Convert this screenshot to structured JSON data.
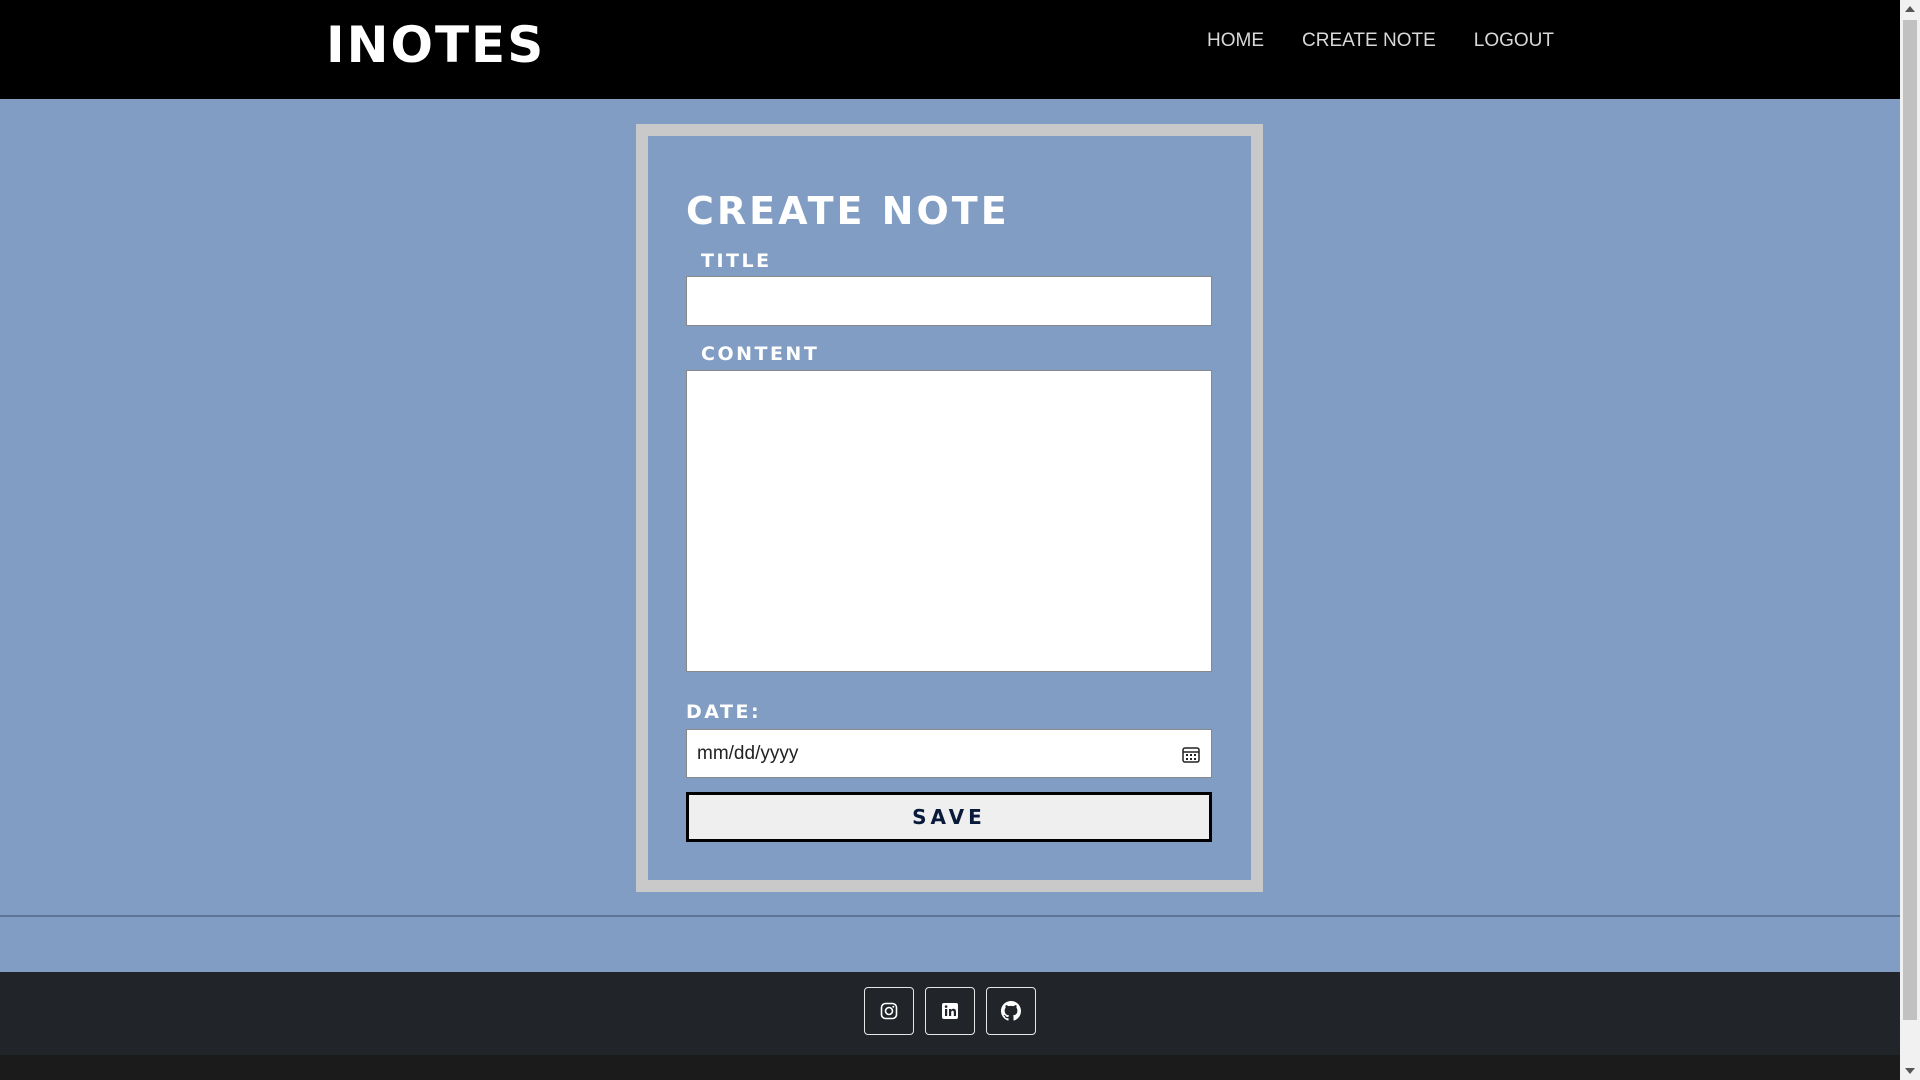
{
  "navbar": {
    "brand": "INOTES",
    "links": [
      {
        "label": "HOME"
      },
      {
        "label": "CREATE NOTE"
      },
      {
        "label": "LOGOUT"
      }
    ]
  },
  "form": {
    "heading": "CREATE NOTE",
    "title_label": "TITLE",
    "title_value": "",
    "content_label": "CONTENT",
    "content_value": "",
    "date_label": "DATE:",
    "date_placeholder": "mm/dd/yyyy",
    "save_label": "SAVE"
  },
  "footer": {
    "social_icons": [
      "instagram-icon",
      "linkedin-icon",
      "github-icon"
    ]
  },
  "colors": {
    "page_bg": "#819dc3",
    "navbar_bg": "#000000",
    "card_border": "#c9c9c9",
    "footer_bg": "#212529"
  }
}
